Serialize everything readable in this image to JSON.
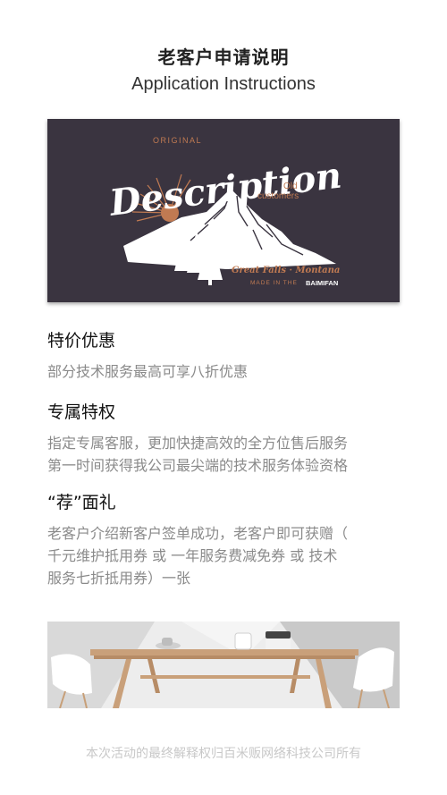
{
  "header": {
    "title_cn": "老客户申请说明",
    "title_en": "Application Instructions"
  },
  "hero": {
    "original": "ORIGINAL",
    "description": "Description",
    "old": "Old",
    "customers": "customers",
    "great_falls": "Great Falls · Montana",
    "made_in_the": "MADE IN THE",
    "brand": "BAIMIFAN",
    "colors": {
      "background": "#3a3440",
      "accent": "#c07a52",
      "white": "#ffffff"
    }
  },
  "sections": [
    {
      "heading": "特价优惠",
      "lines": [
        "部分技术服务最高可享八折优惠"
      ]
    },
    {
      "heading": "专属特权",
      "lines": [
        "指定专属客服，更加快捷高效的全方位售后服务",
        "第一时间获得我公司最尖端的技术服务体验资格"
      ]
    },
    {
      "heading": "“荐”面礼",
      "lines": [
        "老客户介绍新客户签单成功，老客户即可获赠（",
        "千元维护抵用券 或 一年服务费减免券 或 技术",
        "服务七折抵用券）一张"
      ]
    }
  ],
  "footer": {
    "text": "本次活动的最终解释权归百米贩网络科技公司所有"
  }
}
